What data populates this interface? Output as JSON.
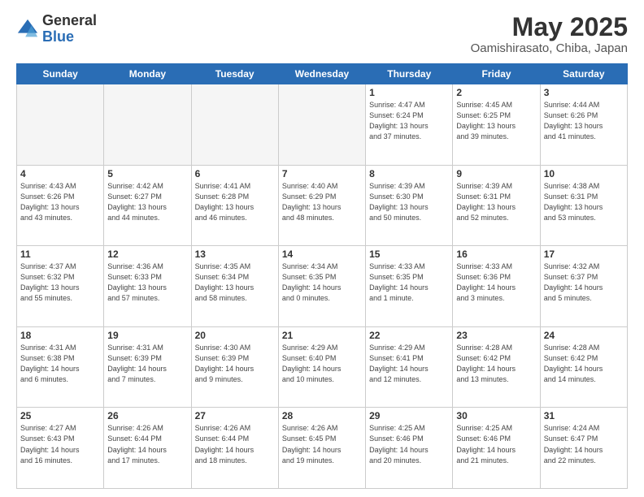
{
  "logo": {
    "general": "General",
    "blue": "Blue"
  },
  "title": "May 2025",
  "subtitle": "Oamishirasato, Chiba, Japan",
  "days_of_week": [
    "Sunday",
    "Monday",
    "Tuesday",
    "Wednesday",
    "Thursday",
    "Friday",
    "Saturday"
  ],
  "weeks": [
    [
      {
        "day": "",
        "info": ""
      },
      {
        "day": "",
        "info": ""
      },
      {
        "day": "",
        "info": ""
      },
      {
        "day": "",
        "info": ""
      },
      {
        "day": "1",
        "info": "Sunrise: 4:47 AM\nSunset: 6:24 PM\nDaylight: 13 hours\nand 37 minutes."
      },
      {
        "day": "2",
        "info": "Sunrise: 4:45 AM\nSunset: 6:25 PM\nDaylight: 13 hours\nand 39 minutes."
      },
      {
        "day": "3",
        "info": "Sunrise: 4:44 AM\nSunset: 6:26 PM\nDaylight: 13 hours\nand 41 minutes."
      }
    ],
    [
      {
        "day": "4",
        "info": "Sunrise: 4:43 AM\nSunset: 6:26 PM\nDaylight: 13 hours\nand 43 minutes."
      },
      {
        "day": "5",
        "info": "Sunrise: 4:42 AM\nSunset: 6:27 PM\nDaylight: 13 hours\nand 44 minutes."
      },
      {
        "day": "6",
        "info": "Sunrise: 4:41 AM\nSunset: 6:28 PM\nDaylight: 13 hours\nand 46 minutes."
      },
      {
        "day": "7",
        "info": "Sunrise: 4:40 AM\nSunset: 6:29 PM\nDaylight: 13 hours\nand 48 minutes."
      },
      {
        "day": "8",
        "info": "Sunrise: 4:39 AM\nSunset: 6:30 PM\nDaylight: 13 hours\nand 50 minutes."
      },
      {
        "day": "9",
        "info": "Sunrise: 4:39 AM\nSunset: 6:31 PM\nDaylight: 13 hours\nand 52 minutes."
      },
      {
        "day": "10",
        "info": "Sunrise: 4:38 AM\nSunset: 6:31 PM\nDaylight: 13 hours\nand 53 minutes."
      }
    ],
    [
      {
        "day": "11",
        "info": "Sunrise: 4:37 AM\nSunset: 6:32 PM\nDaylight: 13 hours\nand 55 minutes."
      },
      {
        "day": "12",
        "info": "Sunrise: 4:36 AM\nSunset: 6:33 PM\nDaylight: 13 hours\nand 57 minutes."
      },
      {
        "day": "13",
        "info": "Sunrise: 4:35 AM\nSunset: 6:34 PM\nDaylight: 13 hours\nand 58 minutes."
      },
      {
        "day": "14",
        "info": "Sunrise: 4:34 AM\nSunset: 6:35 PM\nDaylight: 14 hours\nand 0 minutes."
      },
      {
        "day": "15",
        "info": "Sunrise: 4:33 AM\nSunset: 6:35 PM\nDaylight: 14 hours\nand 1 minute."
      },
      {
        "day": "16",
        "info": "Sunrise: 4:33 AM\nSunset: 6:36 PM\nDaylight: 14 hours\nand 3 minutes."
      },
      {
        "day": "17",
        "info": "Sunrise: 4:32 AM\nSunset: 6:37 PM\nDaylight: 14 hours\nand 5 minutes."
      }
    ],
    [
      {
        "day": "18",
        "info": "Sunrise: 4:31 AM\nSunset: 6:38 PM\nDaylight: 14 hours\nand 6 minutes."
      },
      {
        "day": "19",
        "info": "Sunrise: 4:31 AM\nSunset: 6:39 PM\nDaylight: 14 hours\nand 7 minutes."
      },
      {
        "day": "20",
        "info": "Sunrise: 4:30 AM\nSunset: 6:39 PM\nDaylight: 14 hours\nand 9 minutes."
      },
      {
        "day": "21",
        "info": "Sunrise: 4:29 AM\nSunset: 6:40 PM\nDaylight: 14 hours\nand 10 minutes."
      },
      {
        "day": "22",
        "info": "Sunrise: 4:29 AM\nSunset: 6:41 PM\nDaylight: 14 hours\nand 12 minutes."
      },
      {
        "day": "23",
        "info": "Sunrise: 4:28 AM\nSunset: 6:42 PM\nDaylight: 14 hours\nand 13 minutes."
      },
      {
        "day": "24",
        "info": "Sunrise: 4:28 AM\nSunset: 6:42 PM\nDaylight: 14 hours\nand 14 minutes."
      }
    ],
    [
      {
        "day": "25",
        "info": "Sunrise: 4:27 AM\nSunset: 6:43 PM\nDaylight: 14 hours\nand 16 minutes."
      },
      {
        "day": "26",
        "info": "Sunrise: 4:26 AM\nSunset: 6:44 PM\nDaylight: 14 hours\nand 17 minutes."
      },
      {
        "day": "27",
        "info": "Sunrise: 4:26 AM\nSunset: 6:44 PM\nDaylight: 14 hours\nand 18 minutes."
      },
      {
        "day": "28",
        "info": "Sunrise: 4:26 AM\nSunset: 6:45 PM\nDaylight: 14 hours\nand 19 minutes."
      },
      {
        "day": "29",
        "info": "Sunrise: 4:25 AM\nSunset: 6:46 PM\nDaylight: 14 hours\nand 20 minutes."
      },
      {
        "day": "30",
        "info": "Sunrise: 4:25 AM\nSunset: 6:46 PM\nDaylight: 14 hours\nand 21 minutes."
      },
      {
        "day": "31",
        "info": "Sunrise: 4:24 AM\nSunset: 6:47 PM\nDaylight: 14 hours\nand 22 minutes."
      }
    ]
  ]
}
